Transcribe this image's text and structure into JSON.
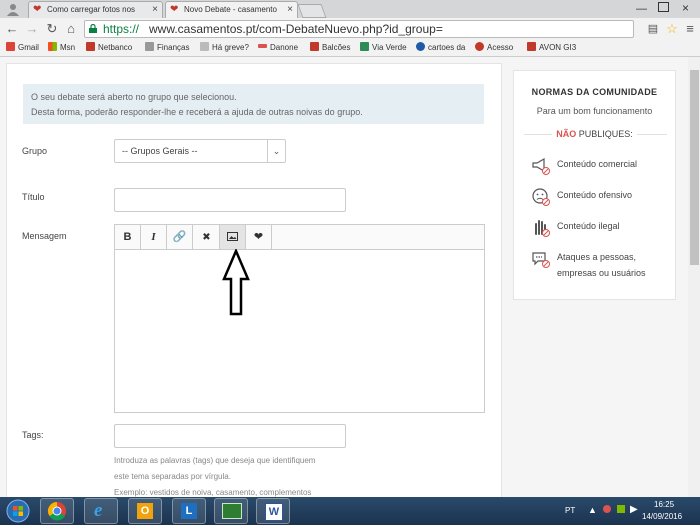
{
  "browser": {
    "tabs": [
      {
        "title": "Como carregar fotos nos",
        "active": false
      },
      {
        "title": "Novo Debate - casamento",
        "active": true
      }
    ],
    "url_scheme": "https://",
    "url_rest": "www.casamentos.pt/com-DebateNuevo.php?id_group=",
    "bookmarks": [
      "Gmail",
      "Msn",
      "Netbanco",
      "Finanças",
      "Há greve?",
      "Danone",
      "Balcões",
      "Via Verde",
      "cartoes da",
      "Acesso",
      "AVON GI3"
    ]
  },
  "form": {
    "info_line1": "O seu debate será aberto no grupo que selecionou.",
    "info_line2": "Desta forma, poderão responder-lhe e receberá a ajuda de outras noivas do grupo.",
    "group_label": "Grupo",
    "group_value": "-- Grupos Gerais --",
    "title_label": "Título",
    "message_label": "Mensagem",
    "tags_label": "Tags:",
    "tags_hint1": "Introduza as palavras (tags) que deseja que identifiquem",
    "tags_hint2": "este tema separadas por vírgula.",
    "tags_hint3": "Exemplo: vestidos de noiva, casamento, complementos",
    "toolbar": {
      "bold": "B",
      "italic": "I"
    }
  },
  "sidebar": {
    "heading": "NORMAS DA COMUNIDADE",
    "subheading": "Para um bom funcionamento",
    "nao": "NÃO",
    "publiques": " PUBLIQUES:",
    "rules": [
      "Conteúdo comercial",
      "Conteúdo ofensivo",
      "Conteúdo ilegal",
      "Ataques a pessoas,",
      "empresas ou usuários"
    ],
    "accent_color": "#d9534f"
  },
  "taskbar": {
    "language": "PT",
    "time": "16:25",
    "date": "14/09/2016"
  }
}
